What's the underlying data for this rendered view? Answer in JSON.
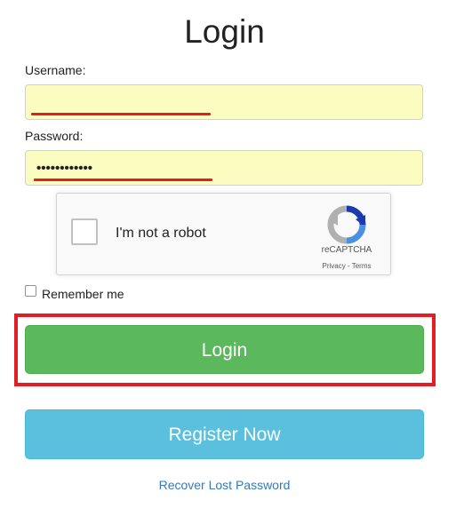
{
  "title": "Login",
  "username": {
    "label": "Username:",
    "value": ""
  },
  "password": {
    "label": "Password:",
    "masked_value": "••••••••••••"
  },
  "recaptcha": {
    "checkbox_label": "I'm not a robot",
    "brand": "reCAPTCHA",
    "privacy": "Privacy",
    "separator": " - ",
    "terms": "Terms",
    "checked": false
  },
  "remember_me": {
    "label": "Remember me",
    "checked": false
  },
  "buttons": {
    "login": "Login",
    "register": "Register Now"
  },
  "recover_link": "Recover Lost Password",
  "colors": {
    "input_background": "#fafdbf",
    "login_button": "#5cb85c",
    "register_button": "#5bc0de",
    "highlight": "#e21d24",
    "link": "#337ab7"
  }
}
